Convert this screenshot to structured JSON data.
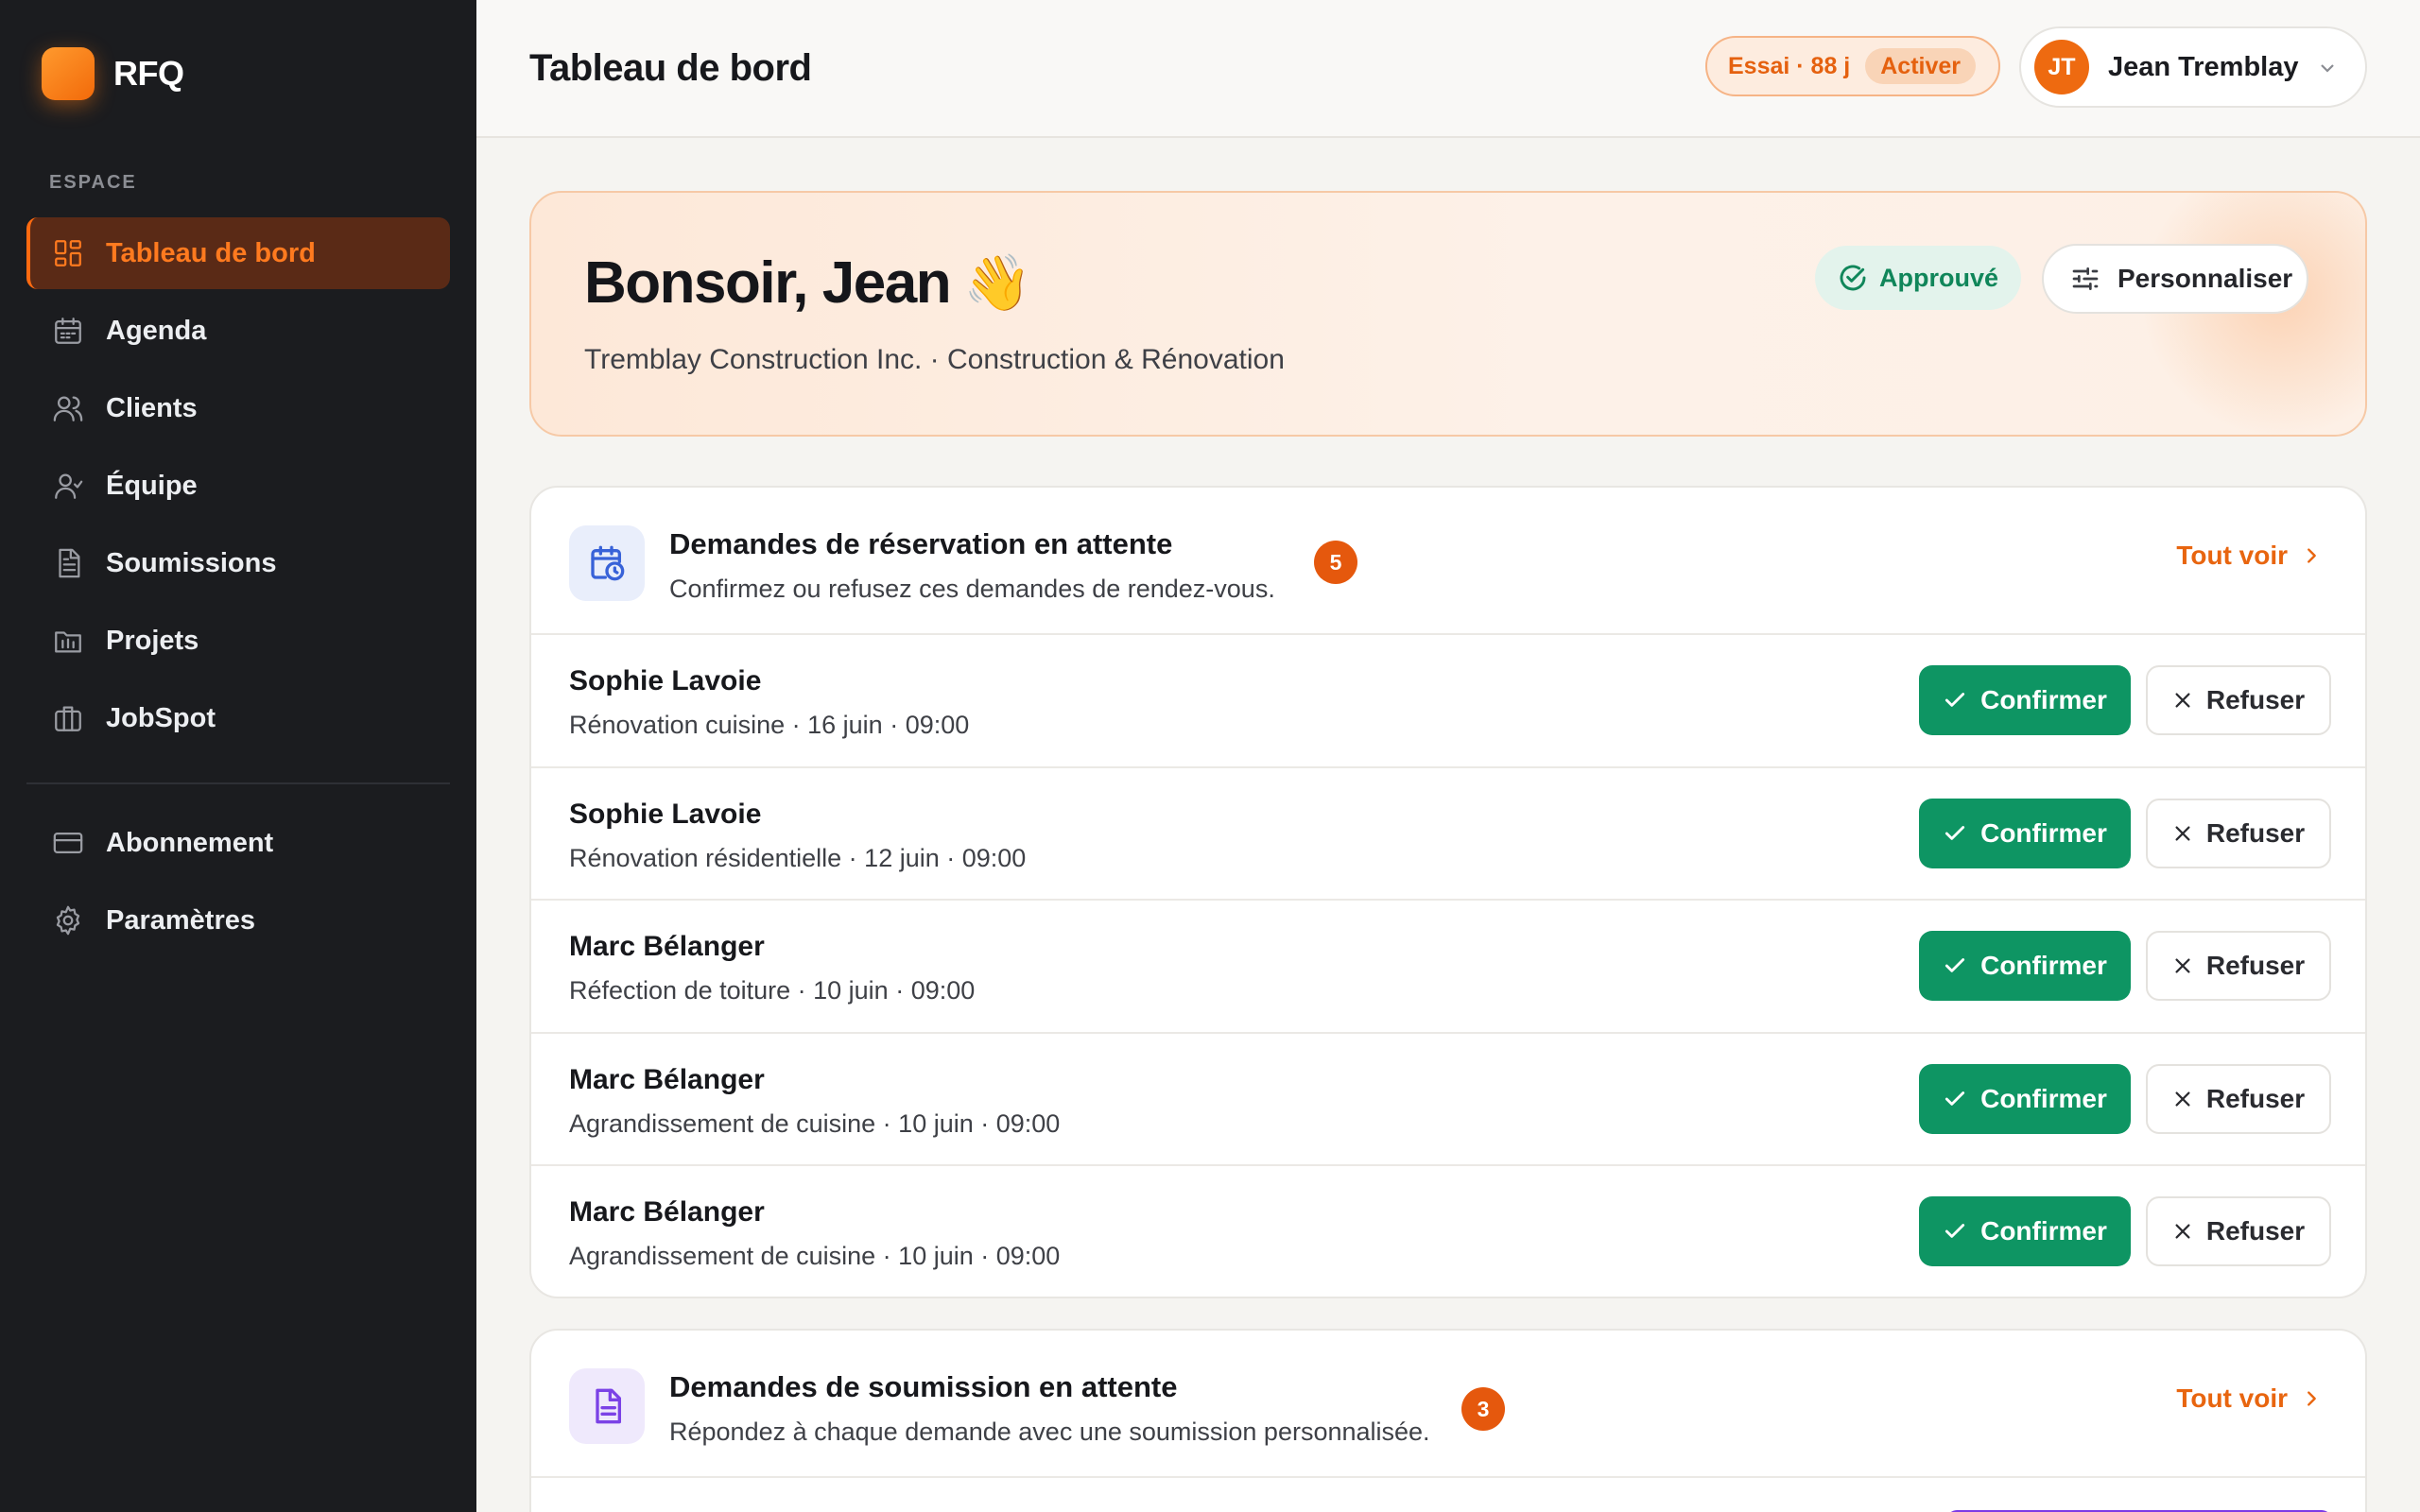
{
  "brand": {
    "name": "RFQ"
  },
  "sidebar": {
    "section_label": "ESPACE",
    "items": [
      {
        "label": "Tableau de bord",
        "icon": "dashboard-icon",
        "active": true
      },
      {
        "label": "Agenda",
        "icon": "calendar-icon"
      },
      {
        "label": "Clients",
        "icon": "clients-icon"
      },
      {
        "label": "Équipe",
        "icon": "team-icon"
      },
      {
        "label": "Soumissions",
        "icon": "document-icon"
      },
      {
        "label": "Projets",
        "icon": "projects-icon"
      },
      {
        "label": "JobSpot",
        "icon": "briefcase-icon"
      }
    ],
    "bottom_items": [
      {
        "label": "Abonnement",
        "icon": "credit-card-icon"
      },
      {
        "label": "Paramètres",
        "icon": "gear-icon"
      }
    ]
  },
  "header": {
    "title": "Tableau de bord",
    "trial": {
      "text": "Essai · 88 j",
      "action": "Activer"
    },
    "user": {
      "initials": "JT",
      "name": "Jean Tremblay"
    }
  },
  "hero": {
    "greeting": "Bonsoir, Jean",
    "emoji": "👋",
    "company": "Tremblay Construction Inc. · Construction & Rénovation",
    "status": "Approuvé",
    "customize_label": "Personnaliser"
  },
  "bookings": {
    "title": "Demandes de réservation en attente",
    "subtitle": "Confirmez ou refusez ces demandes de rendez-vous.",
    "count": "5",
    "see_all": "Tout voir",
    "confirm_label": "Confirmer",
    "refuse_label": "Refuser",
    "rows": [
      {
        "name": "Sophie Lavoie",
        "detail": "Rénovation cuisine · 16 juin · 09:00"
      },
      {
        "name": "Sophie Lavoie",
        "detail": "Rénovation résidentielle · 12 juin · 09:00"
      },
      {
        "name": "Marc Bélanger",
        "detail": "Réfection de toiture · 10 juin · 09:00"
      },
      {
        "name": "Marc Bélanger",
        "detail": "Agrandissement de cuisine · 10 juin · 09:00"
      },
      {
        "name": "Marc Bélanger",
        "detail": "Agrandissement de cuisine · 10 juin · 09:00"
      }
    ]
  },
  "quotes": {
    "title": "Demandes de soumission en attente",
    "subtitle": "Répondez à chaque demande avec une soumission personnalisée.",
    "count": "3",
    "see_all": "Tout voir"
  },
  "colors": {
    "accent": "#ff6a10",
    "confirm": "#0e9563",
    "sidebar_bg": "#1b1c1f",
    "approved": "#10865a"
  }
}
